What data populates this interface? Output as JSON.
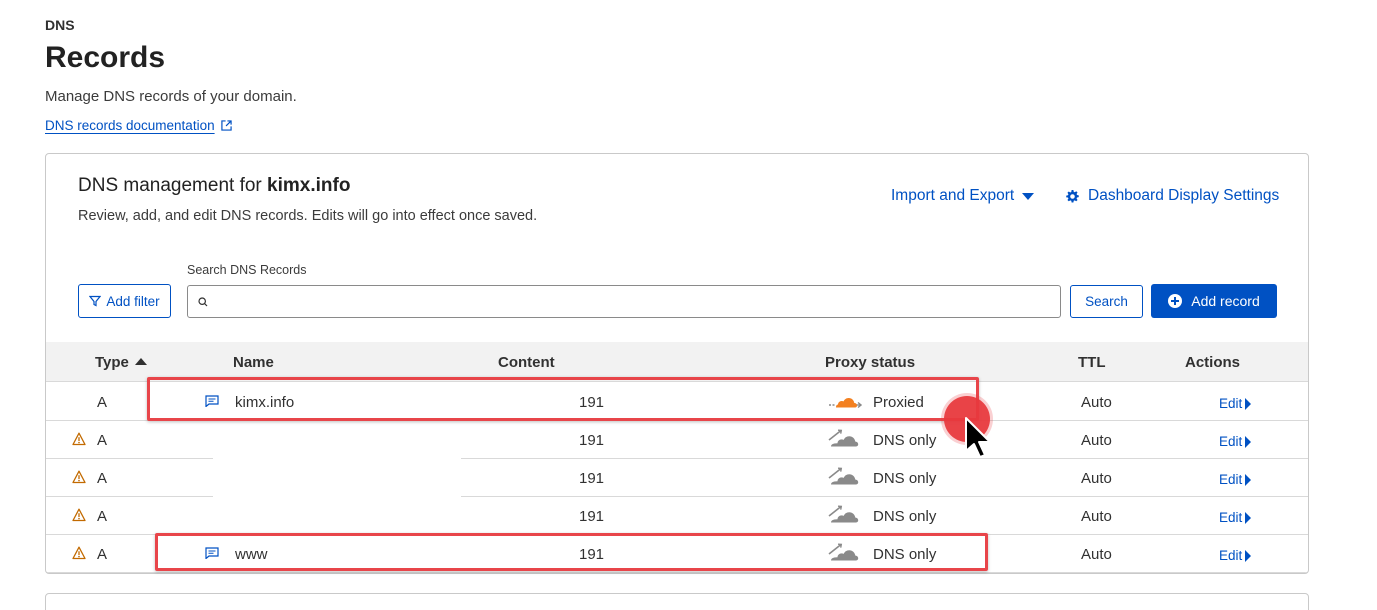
{
  "header": {
    "breadcrumb": "DNS",
    "title": "Records",
    "subtitle": "Manage DNS records of your domain.",
    "doc_link": "DNS records documentation"
  },
  "card": {
    "title_prefix": "DNS management for ",
    "domain": "kimx.info",
    "description": "Review, add, and edit DNS records. Edits will go into effect once saved.",
    "import_export": "Import and Export",
    "dashboard_settings": "Dashboard Display Settings"
  },
  "toolbar": {
    "add_filter": "Add filter",
    "search_label": "Search DNS Records",
    "search_value": "",
    "search_button": "Search",
    "add_record": "Add record"
  },
  "table": {
    "columns": [
      "Type",
      "Name",
      "Content",
      "Proxy status",
      "TTL",
      "Actions"
    ],
    "rows": [
      {
        "warning": false,
        "type": "A",
        "name": "kimx.info",
        "content": "191",
        "proxy": "Proxied",
        "ttl": "Auto",
        "action": "Edit"
      },
      {
        "warning": true,
        "type": "A",
        "name": "",
        "content": "191",
        "proxy": "DNS only",
        "ttl": "Auto",
        "action": "Edit"
      },
      {
        "warning": true,
        "type": "A",
        "name": "",
        "content": "191",
        "proxy": "DNS only",
        "ttl": "Auto",
        "action": "Edit"
      },
      {
        "warning": true,
        "type": "A",
        "name": "",
        "content": "191",
        "proxy": "DNS only",
        "ttl": "Auto",
        "action": "Edit"
      },
      {
        "warning": true,
        "type": "A",
        "name": "www",
        "content": "191",
        "proxy": "DNS only",
        "ttl": "Auto",
        "action": "Edit"
      }
    ]
  },
  "colors": {
    "link_blue": "#0051c3",
    "proxied_orange": "#f38020",
    "dns_only_gray": "#8a8a8a",
    "warning_orange": "#c26a00",
    "highlight_red": "#e8454a"
  }
}
